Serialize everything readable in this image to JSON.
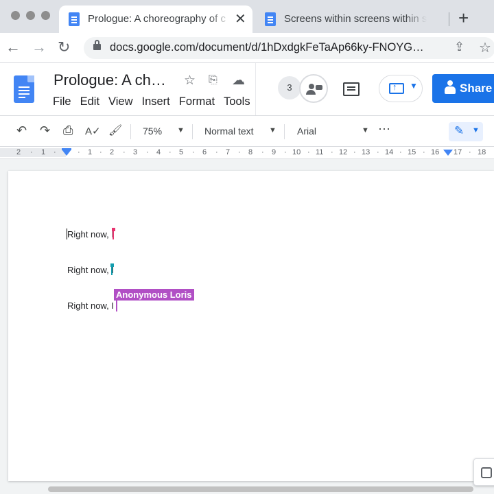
{
  "browser": {
    "tabs": [
      {
        "title": "Prologue: A choreography of c",
        "close": "✕",
        "active": true
      },
      {
        "title": "Screens within screens within s",
        "close": "",
        "active": false
      }
    ],
    "new_tab": "+",
    "nav": {
      "back": "←",
      "forward": "→",
      "reload": "↻"
    },
    "url": "docs.google.com/document/d/1hDxdgkFeTaAp66ky-FNOYG…",
    "bookmark": "☆",
    "share_page": "⇪"
  },
  "docs_header": {
    "title": "Prologue: A ch…",
    "title_icons": {
      "star": "☆",
      "move": "⎘",
      "cloud": "☁"
    },
    "menu": [
      "File",
      "Edit",
      "View",
      "Insert",
      "Format",
      "Tools"
    ],
    "collaborators_count": "3",
    "share_label": "Share",
    "colors": {
      "accent": "#1a73e8",
      "logo": "#4285f4"
    }
  },
  "toolbar": {
    "undo": "↶",
    "redo": "↷",
    "print": "⎙",
    "spellcheck": "A✓",
    "paint_format": "🖌",
    "zoom": "75%",
    "style": "Normal text",
    "font": "Arial",
    "more": "⋯",
    "mode_icon": "✎"
  },
  "ruler": {
    "ticks": [
      "2",
      "·",
      "1",
      "·",
      "·",
      "1",
      "·",
      "2",
      "·",
      "3",
      "·",
      "4",
      "·",
      "5",
      "·",
      "6",
      "·",
      "7",
      "·",
      "8",
      "·",
      "9",
      "·",
      "10",
      "·",
      "11",
      "·",
      "12",
      "·",
      "13",
      "·",
      "14",
      "·",
      "15",
      "·",
      "16",
      "·",
      "17",
      "·",
      "18"
    ]
  },
  "document": {
    "lines": [
      "Right now, I",
      "Right now, I",
      "Right now, I"
    ],
    "collaborator_label": "Anonymous Loris",
    "cursor_colors": [
      "#e8336f",
      "#129eaf",
      "#b14fc5"
    ]
  }
}
